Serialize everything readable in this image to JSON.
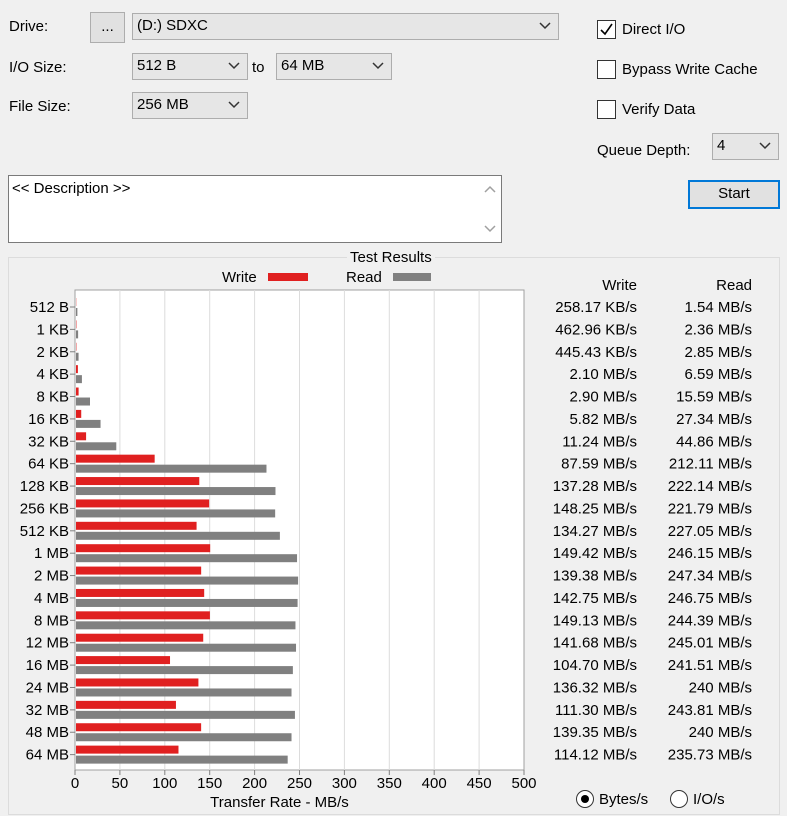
{
  "form": {
    "drive_label": "Drive:",
    "browse_button": "...",
    "drive_value": "(D:) SDXC",
    "io_size_label": "I/O Size:",
    "io_from": "512 B",
    "to_label": "to",
    "io_to": "64 MB",
    "file_size_label": "File Size:",
    "file_size_value": "256 MB",
    "direct_io_label": "Direct I/O",
    "direct_io_checked": true,
    "bypass_cache_label": "Bypass Write Cache",
    "bypass_cache_checked": false,
    "verify_label": "Verify Data",
    "verify_checked": false,
    "queue_depth_label": "Queue Depth:",
    "queue_depth_value": "4",
    "start_button": "Start",
    "description": "<< Description >>"
  },
  "results": {
    "group_title": "Test Results",
    "legend_write": "Write",
    "legend_read": "Read",
    "col_write": "Write",
    "col_read": "Read",
    "units_bytes": "Bytes/s",
    "units_io": "I/O/s",
    "units_selected": "Bytes/s"
  },
  "colors": {
    "write": "#e02020",
    "read": "#808080"
  },
  "chart_data": {
    "type": "bar",
    "orientation": "horizontal",
    "xlabel": "Transfer Rate - MB/s",
    "xlim": [
      0,
      500
    ],
    "xticks": [
      0,
      50,
      100,
      150,
      200,
      250,
      300,
      350,
      400,
      450,
      500
    ],
    "grid": true,
    "legend": "top",
    "categories": [
      "512 B",
      "1 KB",
      "2 KB",
      "4 KB",
      "8 KB",
      "16 KB",
      "32 KB",
      "64 KB",
      "128 KB",
      "256 KB",
      "512 KB",
      "1 MB",
      "2 MB",
      "4 MB",
      "8 MB",
      "12 MB",
      "16 MB",
      "24 MB",
      "32 MB",
      "48 MB",
      "64 MB"
    ],
    "series": [
      {
        "name": "Write",
        "values": [
          0.25,
          0.45,
          0.43,
          2.1,
          2.9,
          5.82,
          11.24,
          87.59,
          137.28,
          148.25,
          134.27,
          149.42,
          139.38,
          142.75,
          149.13,
          141.68,
          104.7,
          136.32,
          111.3,
          139.35,
          114.12
        ],
        "labels": [
          "258.17 KB/s",
          "462.96 KB/s",
          "445.43 KB/s",
          "2.10 MB/s",
          "2.90 MB/s",
          "5.82 MB/s",
          "11.24 MB/s",
          "87.59 MB/s",
          "137.28 MB/s",
          "148.25 MB/s",
          "134.27 MB/s",
          "149.42 MB/s",
          "139.38 MB/s",
          "142.75 MB/s",
          "149.13 MB/s",
          "141.68 MB/s",
          "104.70 MB/s",
          "136.32 MB/s",
          "111.30 MB/s",
          "139.35 MB/s",
          "114.12 MB/s"
        ]
      },
      {
        "name": "Read",
        "values": [
          1.54,
          2.36,
          2.85,
          6.59,
          15.59,
          27.34,
          44.86,
          212.11,
          222.14,
          221.79,
          227.05,
          246.15,
          247.34,
          246.75,
          244.39,
          245.01,
          241.51,
          240,
          243.81,
          240,
          235.73
        ],
        "labels": [
          "1.54 MB/s",
          "2.36 MB/s",
          "2.85 MB/s",
          "6.59 MB/s",
          "15.59 MB/s",
          "27.34 MB/s",
          "44.86 MB/s",
          "212.11 MB/s",
          "222.14 MB/s",
          "221.79 MB/s",
          "227.05 MB/s",
          "246.15 MB/s",
          "247.34 MB/s",
          "246.75 MB/s",
          "244.39 MB/s",
          "245.01 MB/s",
          "241.51 MB/s",
          "240 MB/s",
          "243.81 MB/s",
          "240 MB/s",
          "235.73 MB/s"
        ]
      }
    ]
  }
}
